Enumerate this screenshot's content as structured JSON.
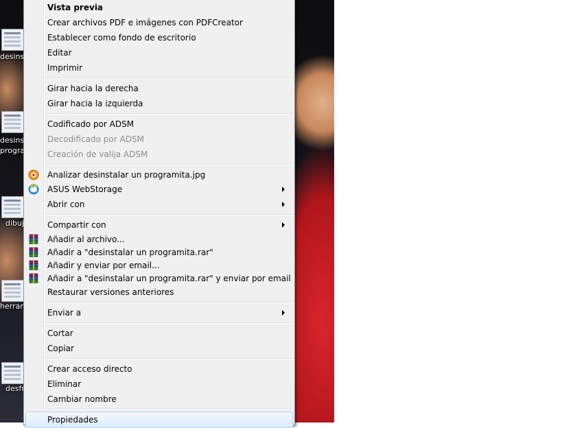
{
  "desktop": {
    "icons": [
      {
        "label": "desinst"
      },
      {
        "label": "desinstal",
        "label2": "program"
      },
      {
        "label": "dibuj"
      },
      {
        "label": "herramie"
      },
      {
        "label": "desfr"
      }
    ]
  },
  "menu": {
    "groups": [
      {
        "items": [
          {
            "label": "Vista previa",
            "style": "bold"
          },
          {
            "label": "Crear archivos PDF e imágenes con PDFCreator"
          },
          {
            "label": "Establecer como fondo de escritorio"
          },
          {
            "label": "Editar"
          },
          {
            "label": "Imprimir"
          }
        ]
      },
      {
        "items": [
          {
            "label": "Girar hacia la derecha"
          },
          {
            "label": "Girar hacia la izquierda"
          }
        ]
      },
      {
        "items": [
          {
            "label": "Codificado por ADSM"
          },
          {
            "label": "Decodificado por ADSM",
            "state": "disabled"
          },
          {
            "label": "Creación de valija ADSM",
            "state": "disabled"
          }
        ]
      },
      {
        "items": [
          {
            "label": "Analizar desinstalar un programita.jpg",
            "icon": "antivirus-scan-icon"
          },
          {
            "label": "ASUS WebStorage",
            "icon": "asus-webstorage-icon",
            "submenu": true
          },
          {
            "label": "Abrir con",
            "submenu": true
          }
        ]
      },
      {
        "items": [
          {
            "label": "Compartir con",
            "submenu": true
          },
          {
            "label": "Añadir al archivo...",
            "icon": "winrar-icon"
          },
          {
            "label": "Añadir a \"desinstalar un programita.rar\"",
            "icon": "winrar-icon"
          },
          {
            "label": "Añadir y enviar por email...",
            "icon": "winrar-icon"
          },
          {
            "label": "Añadir a \"desinstalar un programita.rar\" y enviar por email",
            "icon": "winrar-icon"
          },
          {
            "label": "Restaurar versiones anteriores"
          }
        ]
      },
      {
        "items": [
          {
            "label": "Enviar a",
            "submenu": true
          }
        ]
      },
      {
        "items": [
          {
            "label": "Cortar"
          },
          {
            "label": "Copiar"
          }
        ]
      },
      {
        "items": [
          {
            "label": "Crear acceso directo"
          },
          {
            "label": "Eliminar"
          },
          {
            "label": "Cambiar nombre"
          }
        ]
      },
      {
        "items": [
          {
            "label": "Propiedades",
            "state": "hover"
          }
        ]
      }
    ]
  },
  "colors": {
    "menu_bg": "#f0f0f0",
    "disabled_text": "#8d8d8d",
    "hover_border": "#aecff7"
  }
}
